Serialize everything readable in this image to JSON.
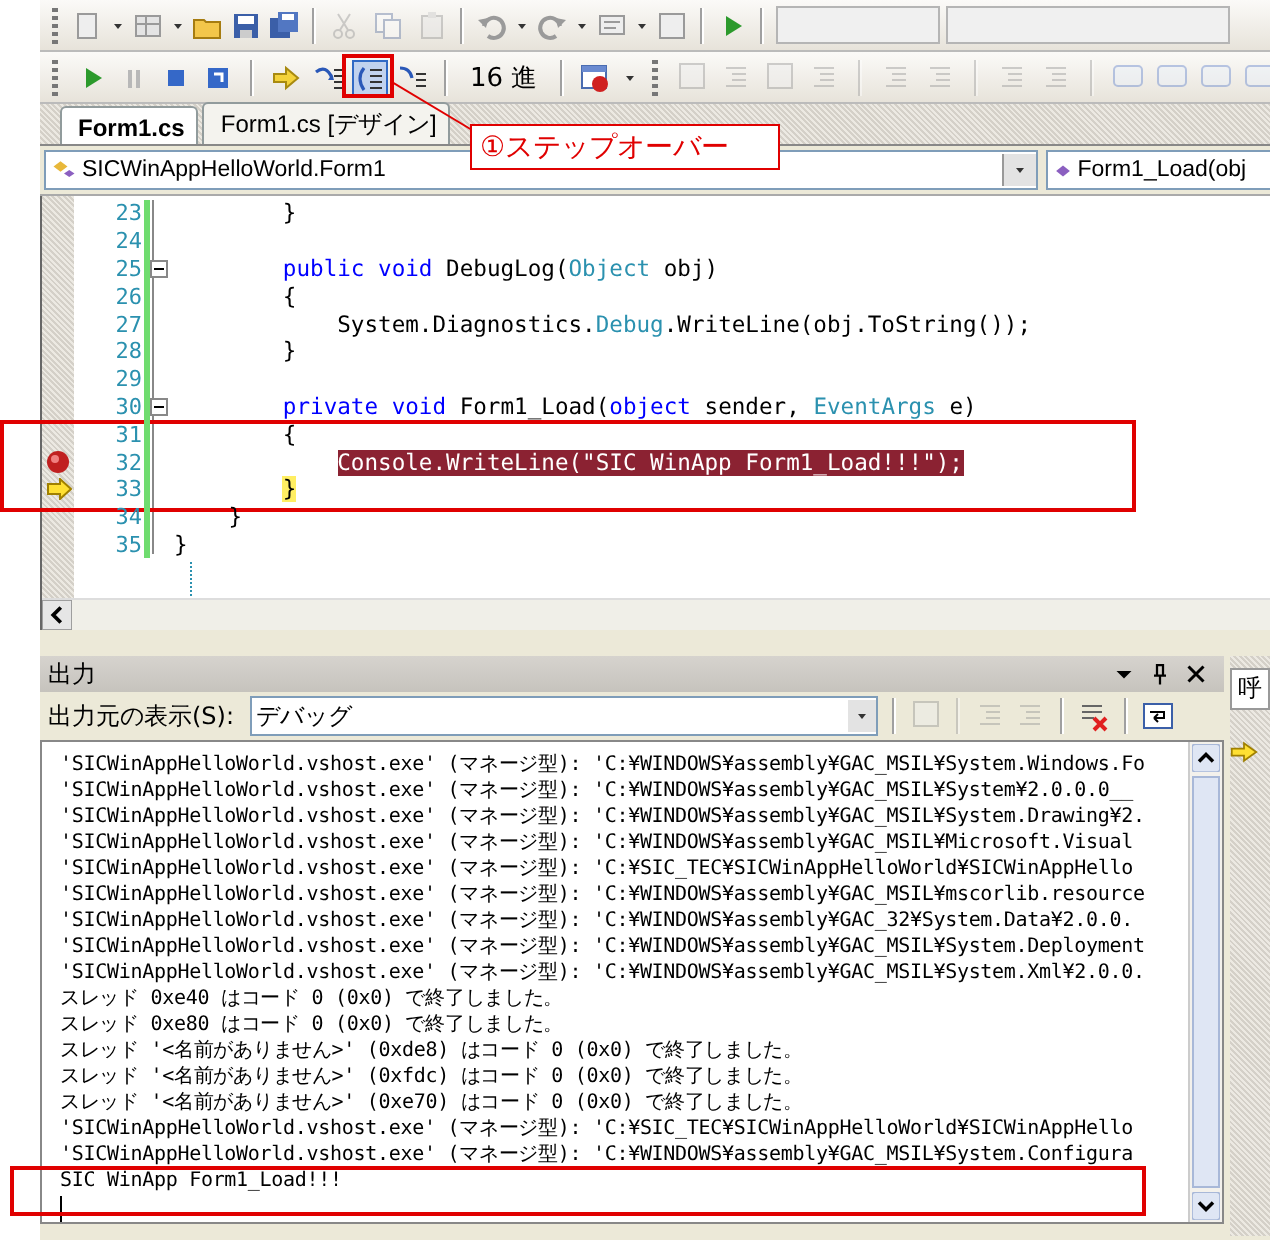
{
  "toolbar": {
    "hex_button": "16 進"
  },
  "annotation": {
    "label": "①ステップオーバー"
  },
  "tabs": [
    {
      "label": "Form1.cs",
      "selected": true
    },
    {
      "label": "Form1.cs [デザイン]",
      "selected": false
    }
  ],
  "navigation": {
    "class_combo": "SICWinAppHelloWorld.Form1",
    "member_combo": "Form1_Load(obj"
  },
  "editor": {
    "lines": [
      {
        "number": "23",
        "collapsible": false,
        "breakpoint": false,
        "current": false,
        "segments": [
          {
            "text": "        }",
            "kind": "plain"
          }
        ]
      },
      {
        "number": "24",
        "collapsible": false,
        "breakpoint": false,
        "current": false
      },
      {
        "number": "25",
        "collapsible": true,
        "breakpoint": false,
        "current": false,
        "segments": [
          {
            "text": "        public void",
            "kind": "keyword"
          },
          {
            "text": " DebugLog(",
            "kind": "plain"
          },
          {
            "text": "Object",
            "kind": "type"
          },
          {
            "text": " obj)",
            "kind": "plain"
          }
        ]
      },
      {
        "number": "26",
        "collapsible": false,
        "breakpoint": false,
        "current": false,
        "segments": [
          {
            "text": "        {",
            "kind": "plain"
          }
        ]
      },
      {
        "number": "27",
        "collapsible": false,
        "breakpoint": false,
        "current": false,
        "segments": [
          {
            "text": "            System.Diagnostics.",
            "kind": "plain"
          },
          {
            "text": "Debug",
            "kind": "type"
          },
          {
            "text": ".WriteLine(obj.ToString());",
            "kind": "plain"
          }
        ]
      },
      {
        "number": "28",
        "collapsible": false,
        "breakpoint": false,
        "current": false,
        "segments": [
          {
            "text": "        }",
            "kind": "plain"
          }
        ]
      },
      {
        "number": "29",
        "collapsible": false,
        "breakpoint": false,
        "current": false
      },
      {
        "number": "30",
        "collapsible": true,
        "breakpoint": false,
        "current": false,
        "segments": [
          {
            "text": "        private void",
            "kind": "keyword"
          },
          {
            "text": " Form1_Load(",
            "kind": "plain"
          },
          {
            "text": "object",
            "kind": "keyword"
          },
          {
            "text": " sender, ",
            "kind": "plain"
          },
          {
            "text": "EventArgs",
            "kind": "type"
          },
          {
            "text": " e)",
            "kind": "plain"
          }
        ]
      },
      {
        "number": "31",
        "collapsible": false,
        "breakpoint": false,
        "current": false,
        "segments": [
          {
            "text": "        {",
            "kind": "plain"
          }
        ]
      },
      {
        "number": "32",
        "collapsible": false,
        "breakpoint": true,
        "current": false,
        "segments": [
          {
            "text": "            Console.WriteLine(\"SIC WinApp Form1_Load!!!\");",
            "kind": "breakpoint"
          }
        ]
      },
      {
        "number": "33",
        "collapsible": false,
        "breakpoint": false,
        "current": true,
        "segments": [
          {
            "text": "        }",
            "kind": "current"
          }
        ]
      },
      {
        "number": "34",
        "collapsible": false,
        "breakpoint": false,
        "current": false,
        "segments": [
          {
            "text": "    }",
            "kind": "plain"
          }
        ]
      },
      {
        "number": "35",
        "collapsible": false,
        "breakpoint": false,
        "current": false,
        "segments": [
          {
            "text": "}",
            "kind": "plain"
          }
        ]
      }
    ]
  },
  "output": {
    "title": "出力",
    "source_label": "出力元の表示(S):",
    "source_value": "デバッグ",
    "lines": [
      "'SICWinAppHelloWorld.vshost.exe' (マネージ型): 'C:¥WINDOWS¥assembly¥GAC_MSIL¥System.Windows.Fo",
      "'SICWinAppHelloWorld.vshost.exe' (マネージ型): 'C:¥WINDOWS¥assembly¥GAC_MSIL¥System¥2.0.0.0__",
      "'SICWinAppHelloWorld.vshost.exe' (マネージ型): 'C:¥WINDOWS¥assembly¥GAC_MSIL¥System.Drawing¥2.",
      "'SICWinAppHelloWorld.vshost.exe' (マネージ型): 'C:¥WINDOWS¥assembly¥GAC_MSIL¥Microsoft.Visual",
      "'SICWinAppHelloWorld.vshost.exe' (マネージ型): 'C:¥SIC_TEC¥SICWinAppHelloWorld¥SICWinAppHello",
      "'SICWinAppHelloWorld.vshost.exe' (マネージ型): 'C:¥WINDOWS¥assembly¥GAC_MSIL¥mscorlib.resource",
      "'SICWinAppHelloWorld.vshost.exe' (マネージ型): 'C:¥WINDOWS¥assembly¥GAC_32¥System.Data¥2.0.0.",
      "'SICWinAppHelloWorld.vshost.exe' (マネージ型): 'C:¥WINDOWS¥assembly¥GAC_MSIL¥System.Deployment",
      "'SICWinAppHelloWorld.vshost.exe' (マネージ型): 'C:¥WINDOWS¥assembly¥GAC_MSIL¥System.Xml¥2.0.0.",
      "スレッド 0xe40 はコード 0 (0x0) で終了しました。",
      "スレッド 0xe80 はコード 0 (0x0) で終了しました。",
      "スレッド '<名前がありません>' (0xde8) はコード 0 (0x0) で終了しました。",
      "スレッド '<名前がありません>' (0xfdc) はコード 0 (0x0) で終了しました。",
      "スレッド '<名前がありません>' (0xe70) はコード 0 (0x0) で終了しました。",
      "'SICWinAppHelloWorld.vshost.exe' (マネージ型): 'C:¥SIC_TEC¥SICWinAppHelloWorld¥SICWinAppHello",
      "'SICWinAppHelloWorld.vshost.exe' (マネージ型): 'C:¥WINDOWS¥assembly¥GAC_MSIL¥System.Configura",
      "SIC WinApp Form1_Load!!!"
    ]
  },
  "side_panel": {
    "tab_label": "呼"
  }
}
